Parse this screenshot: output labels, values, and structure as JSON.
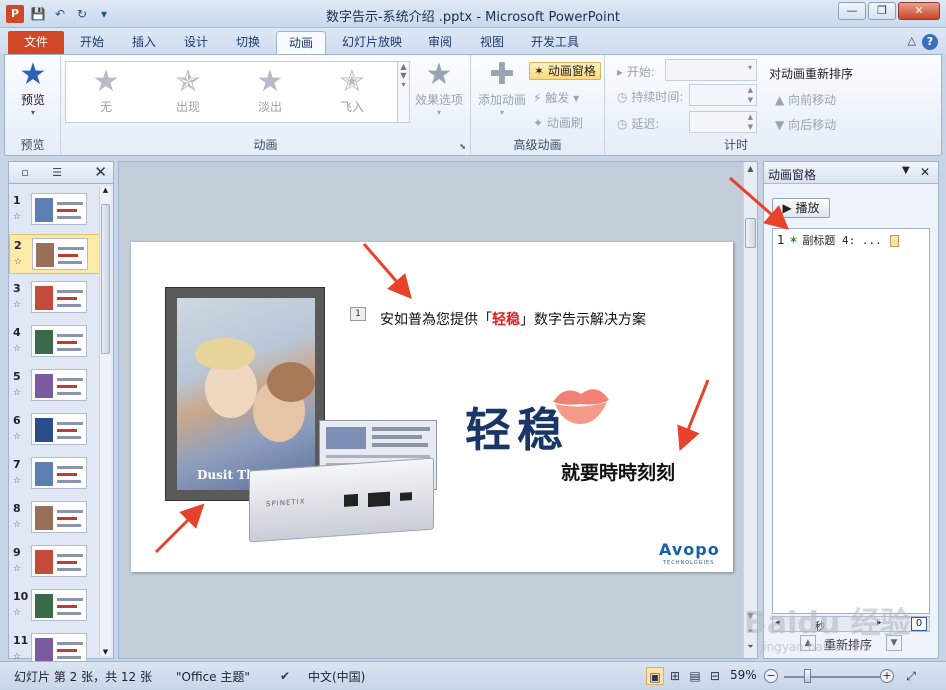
{
  "window": {
    "title": "数字告示-系统介绍 .pptx - Microsoft PowerPoint",
    "controls": [
      "—",
      "❐",
      "✕"
    ]
  },
  "qat": {
    "app": "P",
    "save": "💾",
    "undo": "↶",
    "redo": "↻",
    "more": "▾"
  },
  "tabs": [
    "文件",
    "开始",
    "插入",
    "设计",
    "切换",
    "动画",
    "幻灯片放映",
    "审阅",
    "视图",
    "开发工具"
  ],
  "active_tab": "动画",
  "help": "?",
  "minimize_ribbon": "△",
  "ribbon": {
    "preview_group": {
      "label": "预览",
      "button": "预览"
    },
    "animation_group": {
      "label": "动画",
      "gallery": [
        "无",
        "出现",
        "淡出",
        "飞入"
      ],
      "effect_options": "效果选项"
    },
    "advanced_group": {
      "label": "高级动画",
      "add_animation": "添加动画",
      "animation_pane": "动画窗格",
      "trigger": "触发",
      "painter": "动画刷"
    },
    "timing_group": {
      "label": "计时",
      "start": "开始:",
      "duration": "持续时间:",
      "delay": "延迟:",
      "reorder_title": "对动画重新排序",
      "move_earlier": "向前移动",
      "move_later": "向后移动"
    }
  },
  "thumbnails": {
    "close": "✕",
    "selected": "2",
    "items": [
      "1",
      "2",
      "3",
      "4",
      "5",
      "6",
      "7",
      "8",
      "9",
      "10",
      "11"
    ],
    "star": "☆"
  },
  "slide": {
    "anim_badge": "1",
    "subtitle_pre": "安如普為您提供「",
    "subtitle_red": "轻稳",
    "subtitle_post": "」数字告示解决方案",
    "big_text": "轻稳",
    "tagline": "就要時時刻刻",
    "photo_caption": "Dusit Tha",
    "logo": "Avopo",
    "logo_sub": "TECHNOLOGIES"
  },
  "animation_pane": {
    "title": "动画窗格",
    "play": "▶ 播放",
    "items": [
      {
        "index": "1",
        "label": "副标题 4: ..."
      }
    ],
    "seconds_label": "秒",
    "seconds_value": "0",
    "reorder": "重新排序"
  },
  "status": {
    "slide_info": "幻灯片 第 2 张，共 12 张",
    "theme": "\"Office 主题\"",
    "language": "中文(中国)",
    "zoom": "59%"
  },
  "colors": {
    "accent_file_tab": "#d24726",
    "highlight": "#fde3a8",
    "slide_title_color": "#1a3666",
    "red_text": "#e02020",
    "arrow": "#e8412c"
  },
  "watermark": {
    "text": "Baidu 经验",
    "sub": "jingyan.baidu.com"
  }
}
